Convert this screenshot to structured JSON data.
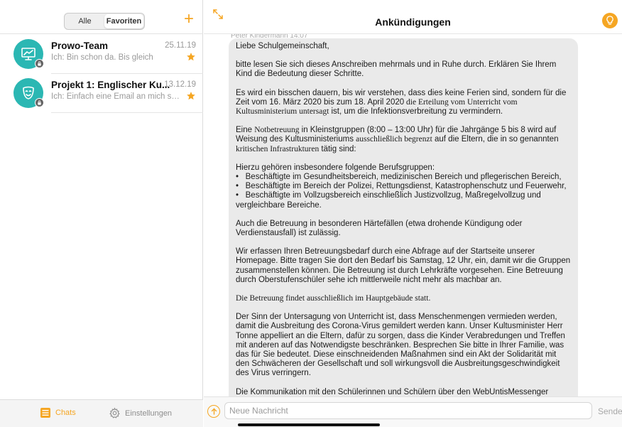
{
  "colors": {
    "accent": "#f5a623",
    "avatar": "#2bb7b3",
    "bubble": "#eaeaea"
  },
  "sidebar": {
    "segments": [
      {
        "label": "Alle",
        "active": false
      },
      {
        "label": "Favoriten",
        "active": true
      }
    ],
    "add_icon": "plus-icon",
    "chats": [
      {
        "title": "Prowo-Team",
        "date": "25.11.19",
        "preview": "Ich: Bin schon da. Bis gleich",
        "favorite": true,
        "icon": "presentation-icon"
      },
      {
        "title": "Projekt 1: Englischer Ku...",
        "date": "13.12.19",
        "preview": "Ich: Einfach eine Email an mich sen...",
        "favorite": true,
        "icon": "theater-mask-icon"
      }
    ],
    "tabs": {
      "chats": "Chats",
      "settings": "Einstellungen"
    }
  },
  "conversation": {
    "title": "Ankündigungen",
    "sender": "Peter Kindermann 14:07",
    "message": {
      "greeting": "Liebe Schulgemeinschaft,",
      "p1": "bitte lesen Sie sich dieses Anschreiben mehrmals und in Ruhe durch. Erklären Sie Ihrem Kind die Bedeutung dieser Schritte.",
      "p2a": "Es wird ein bisschen dauern, bis wir verstehen, dass dies keine Ferien sind, sondern für die Zeit vom 16. März 2020 bis zum 18. April 2020",
      "p2b": " die Erteilung vom Unterricht vom Kultusministerium untersagt",
      "p2c": " ist, um die Infektionsverbreitung zu vermindern.",
      "p3a": "Eine ",
      "p3b": "Notbetreuung",
      "p3c": " in Kleinstgruppen (8:00 – 13:00 Uhr) für die Jahrgänge 5 bis 8 wird auf Weisung des Kultusministeriums ",
      "p3d": "ausschließlich begrenzt",
      "p3e": " auf die Eltern, die in so genannten ",
      "p3f": "kritischen Infrastrukturen",
      "p3g": " tätig sind:",
      "p4_intro": "Hierzu gehören insbesondere folgende Berufsgruppen:",
      "p4_items": [
        "Beschäftigte im Gesundheitsbereich, medizinischen Bereich und pflegerischen Bereich,",
        "Beschäftigte im Bereich der Polizei, Rettungsdienst, Katastrophenschutz und Feuerwehr,",
        "Beschäftigte im Vollzugsbereich einschließlich Justizvollzug, Maßregelvollzug und vergleichbare Bereiche."
      ],
      "p5": "Auch die Betreuung in besonderen Härtefällen (etwa drohende Kündigung oder Verdienstausfall) ist zulässig.",
      "p6": "Wir erfassen Ihren Betreuungsbedarf durch eine Abfrage auf der Startseite unserer Homepage. Bitte tragen Sie dort den Bedarf bis Samstag, 12 Uhr, ein, damit wir die Gruppen zusammenstellen können. Die Betreuung ist durch Lehrkräfte vorgesehen. Eine Betreuung durch Oberstufenschüler sehe ich mittlerweile nicht mehr als machbar an.",
      "p7": "Die Betreuung findet ausschließlich im Hauptgebäude statt.",
      "p8": "Der Sinn der Untersagung von Unterricht ist, dass Menschenmengen vermieden werden, damit die Ausbreitung des Corona-Virus gemildert werden kann. Unser Kultusminister Herr Tonne appelliert an die Eltern, dafür zu sorgen, dass die Kinder Verabredungen und Treffen mit anderen auf das Notwendigste beschränken. Besprechen Sie bitte in Ihrer Familie, was das für Sie bedeutet. Diese einschneidenden Maßnahmen sind ein Akt der Solidarität mit den Schwächeren der Gesellschaft und soll wirkungsvoll die Ausbreitungsgeschwindigkeit des Virus verringern.",
      "p9": "Die Kommunikation mit den Schülerinnen und Schülern über den WebUntisMessenger"
    },
    "input_placeholder": "Neue Nachricht",
    "send_label": "Senden"
  }
}
